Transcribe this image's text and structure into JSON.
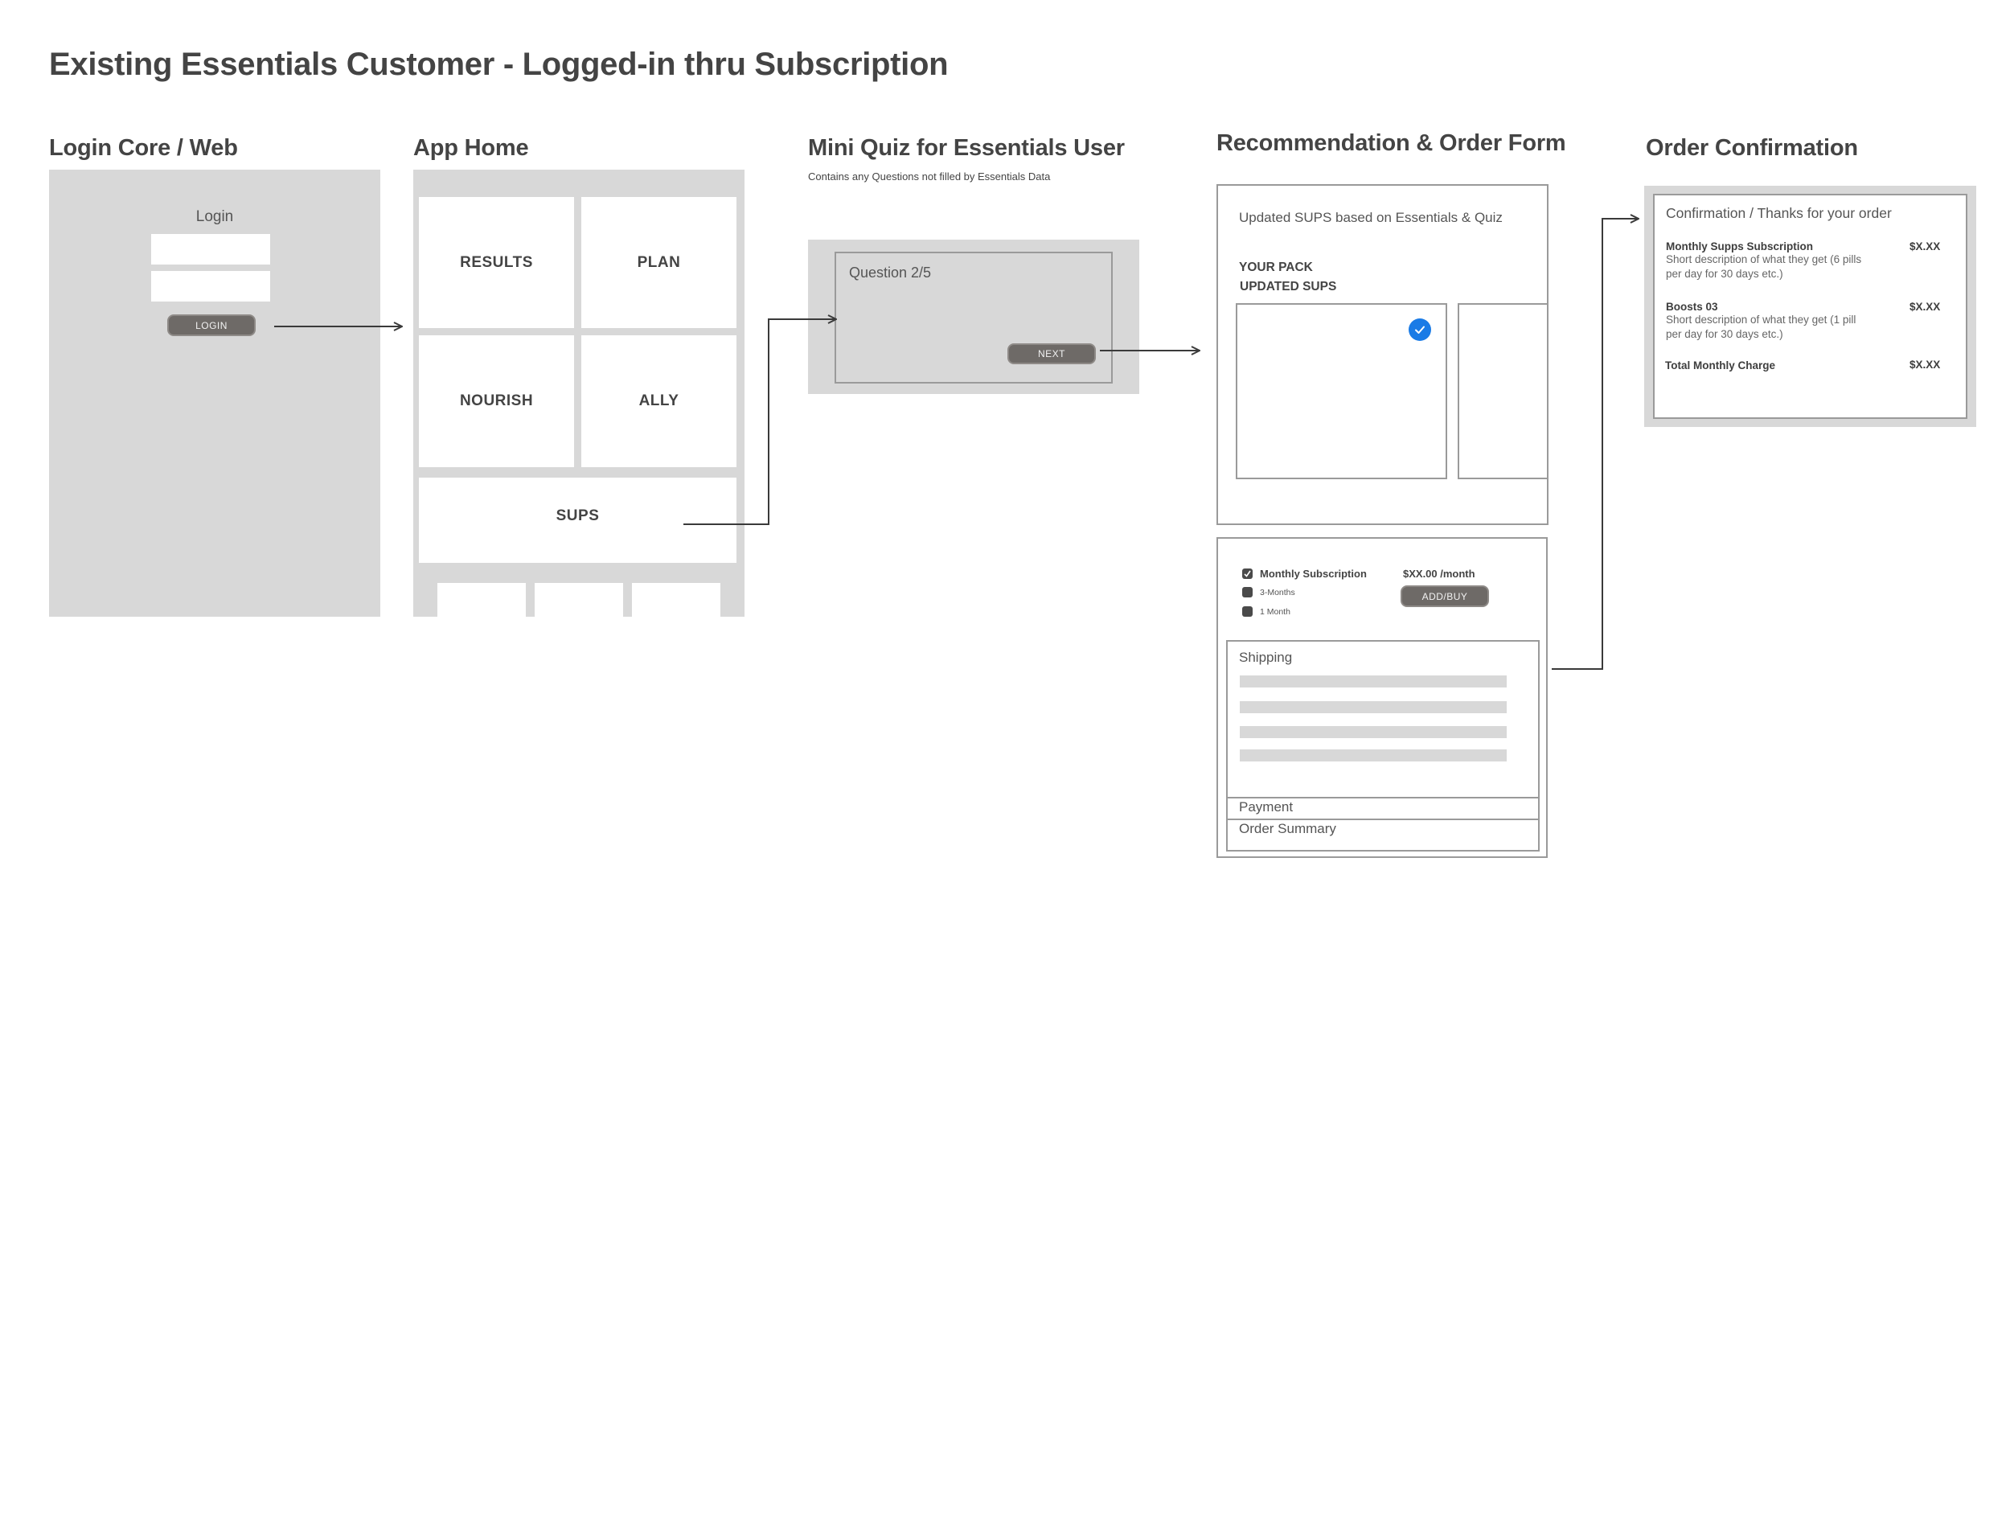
{
  "page": {
    "title": "Existing Essentials Customer - Logged-in thru Subscription"
  },
  "colors": {
    "panel_gray": "#d8d8d8",
    "button_dark": "#6e6a67",
    "check_blue": "#1a7be6",
    "text_dark": "#444444",
    "connector": "#3a3a3a"
  },
  "screens": {
    "login": {
      "title": "Login Core / Web",
      "heading": "Login",
      "username_value": "",
      "password_value": "",
      "button_label": "LOGIN"
    },
    "app_home": {
      "title": "App Home",
      "tiles": [
        "RESULTS",
        "PLAN",
        "NOURISH",
        "ALLY",
        "SUPS"
      ]
    },
    "mini_quiz": {
      "title": "Mini Quiz for Essentials User",
      "subtitle": "Contains any Questions not filled by Essentials Data",
      "question_label": "Question 2/5",
      "button_label": "NEXT"
    },
    "recommendation": {
      "title": "Recommendation & Order Form",
      "intro": "Updated SUPS based on Essentials & Quiz",
      "pack_label": "YOUR PACK",
      "updated_label": "UPDATED SUPS",
      "check_icon": "check-circle-icon",
      "options": [
        {
          "label": "Monthly Subscription",
          "checked": true
        },
        {
          "label": "3-Months",
          "checked": false
        },
        {
          "label": "1 Month",
          "checked": false
        }
      ],
      "price": "$XX.00 /month",
      "button_label": "ADD/BUY",
      "sections": {
        "shipping": "Shipping",
        "payment": "Payment",
        "order_summary": "Order Summary"
      }
    },
    "confirmation": {
      "title": "Order Confirmation",
      "heading": "Confirmation / Thanks for your order",
      "items": [
        {
          "name": "Monthly Supps Subscription",
          "desc_line1": "Short description of what they get (6 pills",
          "desc_line2": "per day for 30 days etc.)",
          "price": "$X.XX"
        },
        {
          "name": "Boosts 03",
          "desc_line1": "Short description of what they get (1 pill",
          "desc_line2": "per day for 30 days etc.)",
          "price": "$X.XX"
        }
      ],
      "total_label": "Total Monthly Charge",
      "total_price": "$X.XX"
    }
  }
}
